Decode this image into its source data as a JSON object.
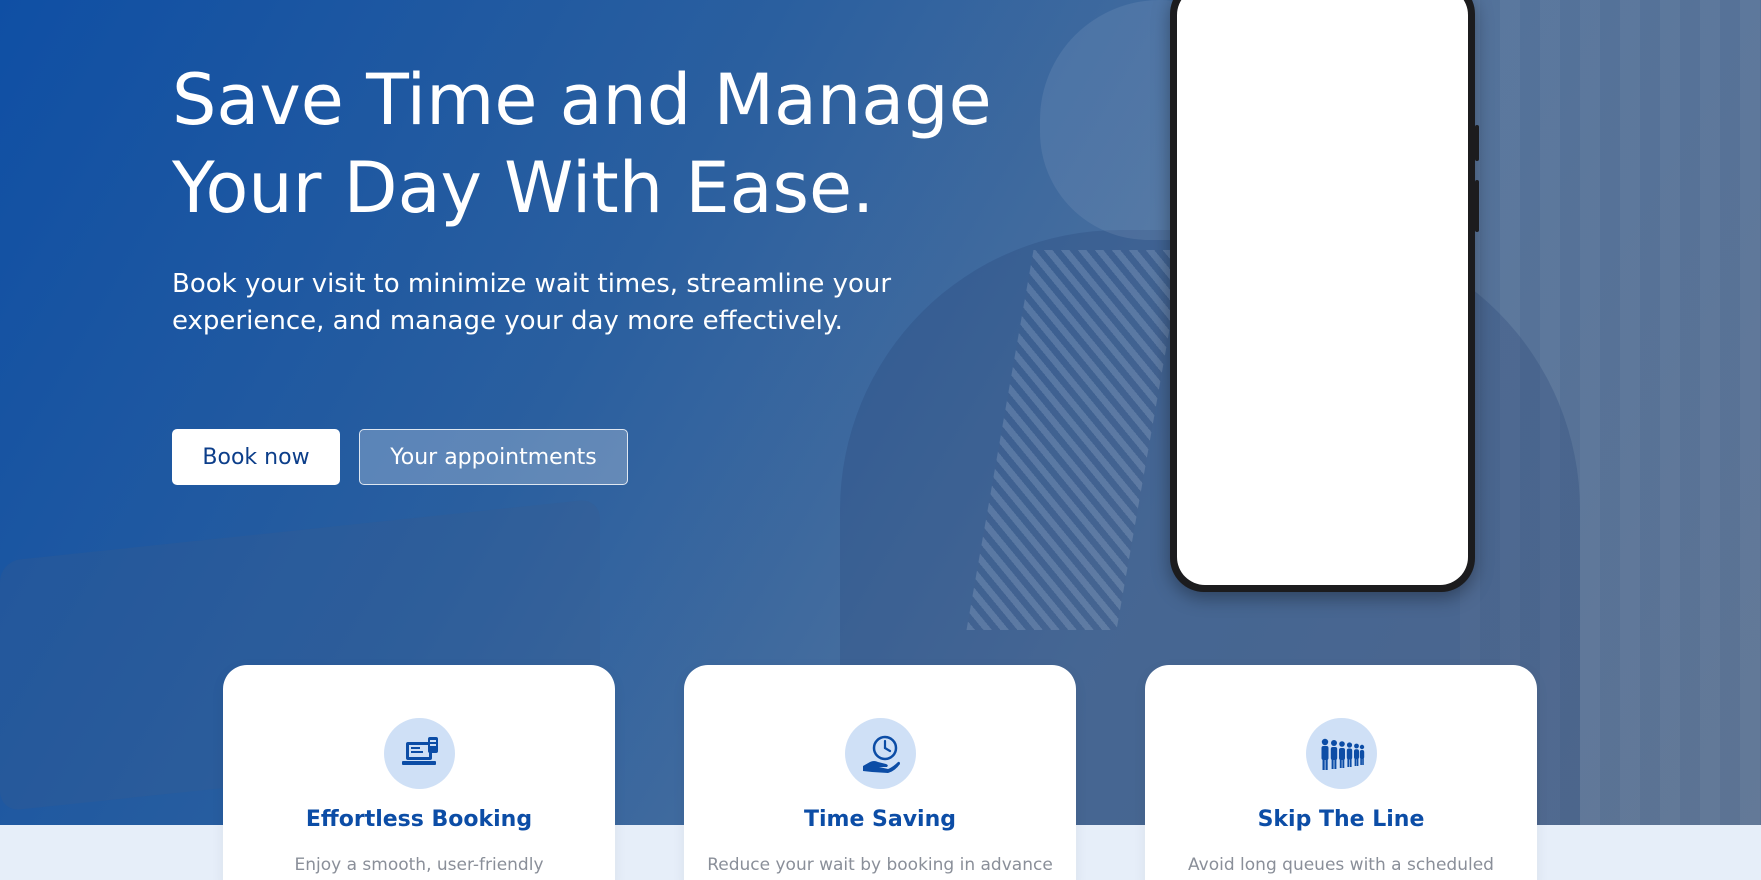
{
  "hero": {
    "title": "Save Time and Manage Your Day With Ease.",
    "subtitle": "Book your visit to minimize wait times, streamline your experience, and manage your day more effectively.",
    "primary_button": "Book now",
    "secondary_button": "Your appointments"
  },
  "features": [
    {
      "title": "Effortless Booking",
      "text": "Enjoy a smooth, user-friendly",
      "icon": "booking-laptop-icon"
    },
    {
      "title": "Time Saving",
      "text": "Reduce your wait by booking in advance",
      "icon": "clock-hand-icon"
    },
    {
      "title": "Skip The Line",
      "text": "Avoid long queues with a scheduled",
      "icon": "queue-people-icon"
    }
  ],
  "colors": {
    "accent": "#0c4da6",
    "hero_blue": "#0f4fa4",
    "icon_bg": "#cfe0f6",
    "section_bg": "#e6eef9"
  }
}
